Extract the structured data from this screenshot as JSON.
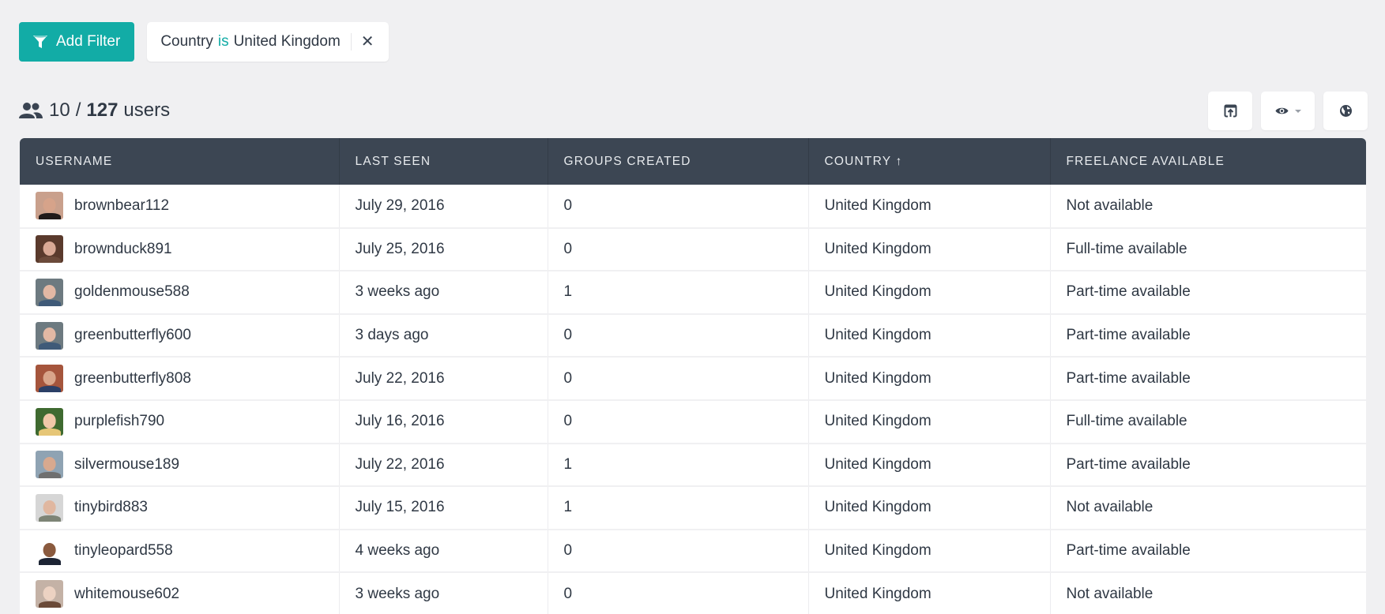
{
  "toolbar": {
    "add_filter_label": "Add Filter",
    "filter_chip": {
      "field": "Country",
      "operator": "is",
      "value": "United Kingdom"
    }
  },
  "summary": {
    "shown": "10",
    "separator": "/",
    "total": "127",
    "unit": "users"
  },
  "actions": [
    {
      "icon": "export-icon"
    },
    {
      "icon": "eye-icon",
      "has_dropdown": true
    },
    {
      "icon": "globe-icon"
    }
  ],
  "table": {
    "columns": [
      "USERNAME",
      "LAST SEEN",
      "GROUPS CREATED",
      "COUNTRY ↑",
      "FREELANCE AVAILABLE"
    ],
    "sort": {
      "column": "COUNTRY",
      "direction": "ascending"
    },
    "rows": [
      {
        "username": "brownbear112",
        "last_seen": "July 29, 2016",
        "groups_created": "0",
        "country": "United Kingdom",
        "freelance": "Not available",
        "avatar": {
          "bg": "#c9a08c",
          "face": "#d6a38a",
          "body": "#1f1a1a"
        }
      },
      {
        "username": "brownduck891",
        "last_seen": "July 25, 2016",
        "groups_created": "0",
        "country": "United Kingdom",
        "freelance": "Full-time available",
        "avatar": {
          "bg": "#5a3a2c",
          "face": "#d9a995",
          "body": "#6b4a3a"
        }
      },
      {
        "username": "goldenmouse588",
        "last_seen": "3 weeks ago",
        "groups_created": "1",
        "country": "United Kingdom",
        "freelance": "Part-time available",
        "avatar": {
          "bg": "#6d7a80",
          "face": "#e2b8a4",
          "body": "#3f5a78"
        }
      },
      {
        "username": "greenbutterfly600",
        "last_seen": "3 days ago",
        "groups_created": "0",
        "country": "United Kingdom",
        "freelance": "Part-time available",
        "avatar": {
          "bg": "#6d7a80",
          "face": "#e2b8a4",
          "body": "#3f5a78"
        }
      },
      {
        "username": "greenbutterfly808",
        "last_seen": "July 22, 2016",
        "groups_created": "0",
        "country": "United Kingdom",
        "freelance": "Part-time available",
        "avatar": {
          "bg": "#a5553c",
          "face": "#d9a58a",
          "body": "#2b3f66"
        }
      },
      {
        "username": "purplefish790",
        "last_seen": "July 16, 2016",
        "groups_created": "0",
        "country": "United Kingdom",
        "freelance": "Full-time available",
        "avatar": {
          "bg": "#3f6a30",
          "face": "#f0c8a8",
          "body": "#e6c677"
        }
      },
      {
        "username": "silvermouse189",
        "last_seen": "July 22, 2016",
        "groups_created": "1",
        "country": "United Kingdom",
        "freelance": "Part-time available",
        "avatar": {
          "bg": "#8fa3b3",
          "face": "#d8a98f",
          "body": "#6f6f6f"
        }
      },
      {
        "username": "tinybird883",
        "last_seen": "July 15, 2016",
        "groups_created": "1",
        "country": "United Kingdom",
        "freelance": "Not available",
        "avatar": {
          "bg": "#d6d6d6",
          "face": "#e0b7a0",
          "body": "#7d8476"
        }
      },
      {
        "username": "tinyleopard558",
        "last_seen": "4 weeks ago",
        "groups_created": "0",
        "country": "United Kingdom",
        "freelance": "Part-time available",
        "avatar": {
          "bg": "#ffffff",
          "face": "#8a5a3e",
          "body": "#1c2434"
        }
      },
      {
        "username": "whitemouse602",
        "last_seen": "3 weeks ago",
        "groups_created": "0",
        "country": "United Kingdom",
        "freelance": "Not available",
        "avatar": {
          "bg": "#c4b2a6",
          "face": "#ecd2c2",
          "body": "#6b4a38"
        }
      }
    ]
  },
  "colors": {
    "accent": "#12aca6",
    "header_bg": "#3c4653",
    "page_bg": "#f0f0f2"
  }
}
